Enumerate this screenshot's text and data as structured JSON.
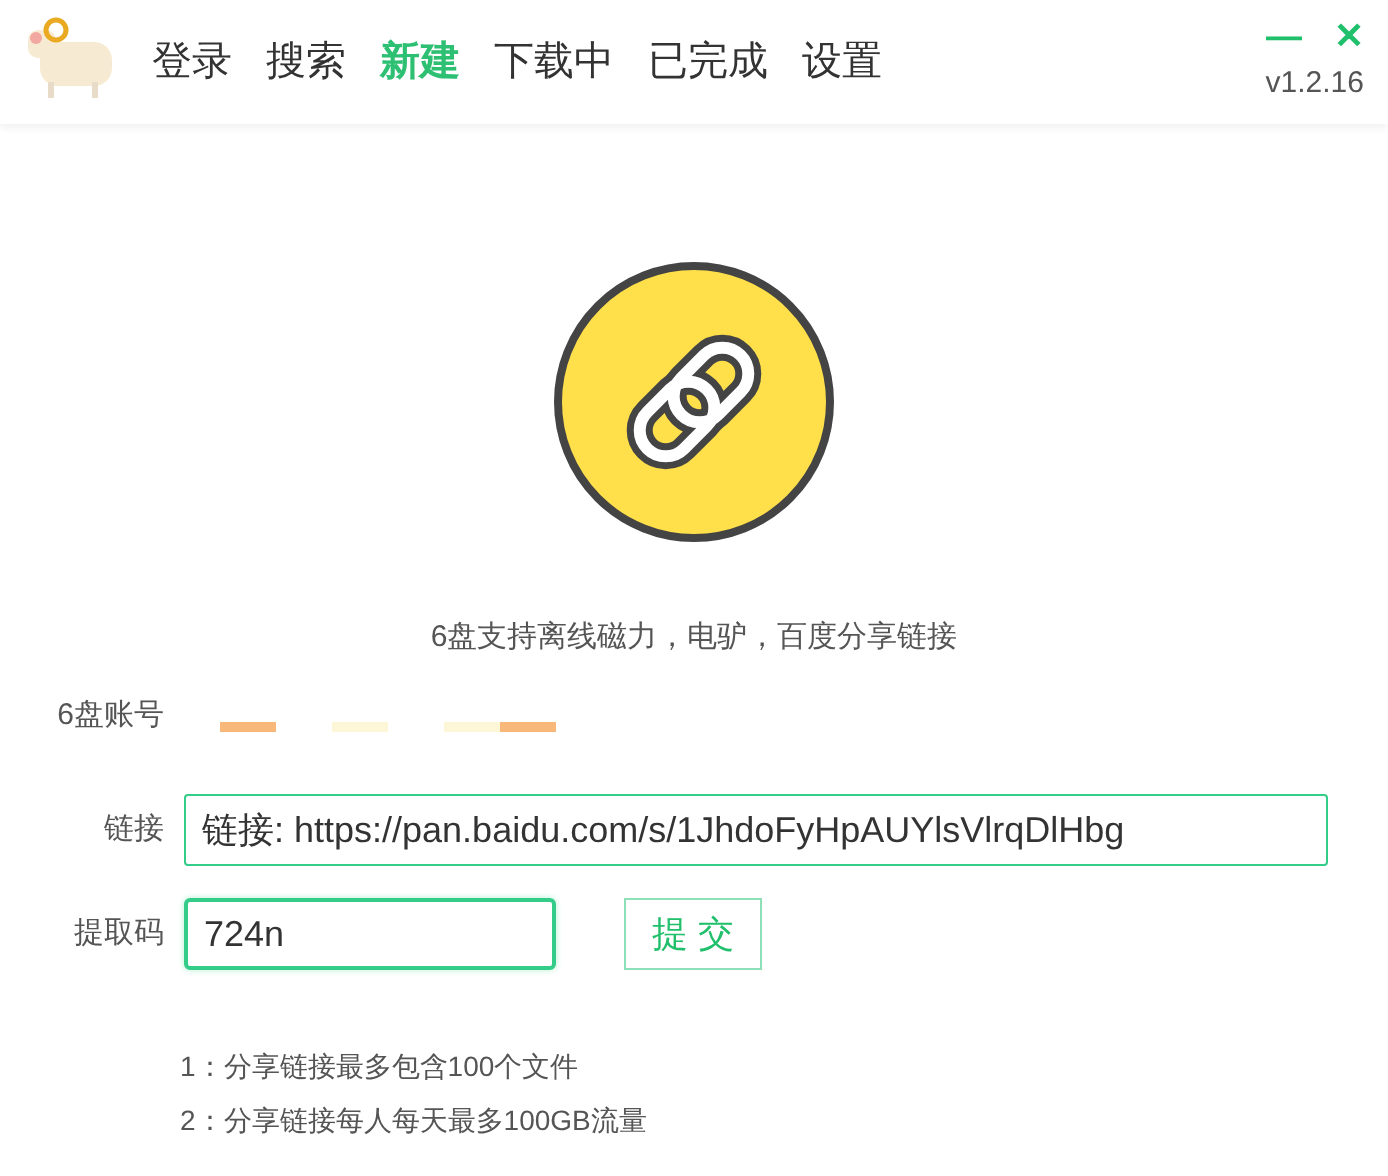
{
  "nav": {
    "tabs": [
      {
        "label": "登录",
        "selected": false
      },
      {
        "label": "搜索",
        "selected": false
      },
      {
        "label": "新建",
        "selected": true
      },
      {
        "label": "下载中",
        "selected": false
      },
      {
        "label": "已完成",
        "selected": false
      },
      {
        "label": "设置",
        "selected": false
      }
    ],
    "minimize": "—",
    "close": "✕",
    "version": "v1.2.16"
  },
  "hero": {
    "caption": "6盘支持离线磁力，电驴，百度分享链接"
  },
  "form": {
    "account_label": "6盘账号",
    "link_label": "链接",
    "link_value": "链接: https://pan.baidu.com/s/1JhdoFyHpAUYlsVlrqDlHbg",
    "code_label": "提取码",
    "code_value": "724n",
    "submit": "提 交"
  },
  "notes": [
    "1：分享链接最多包含100个文件",
    "2：分享链接每人每天最多100GB流量"
  ]
}
